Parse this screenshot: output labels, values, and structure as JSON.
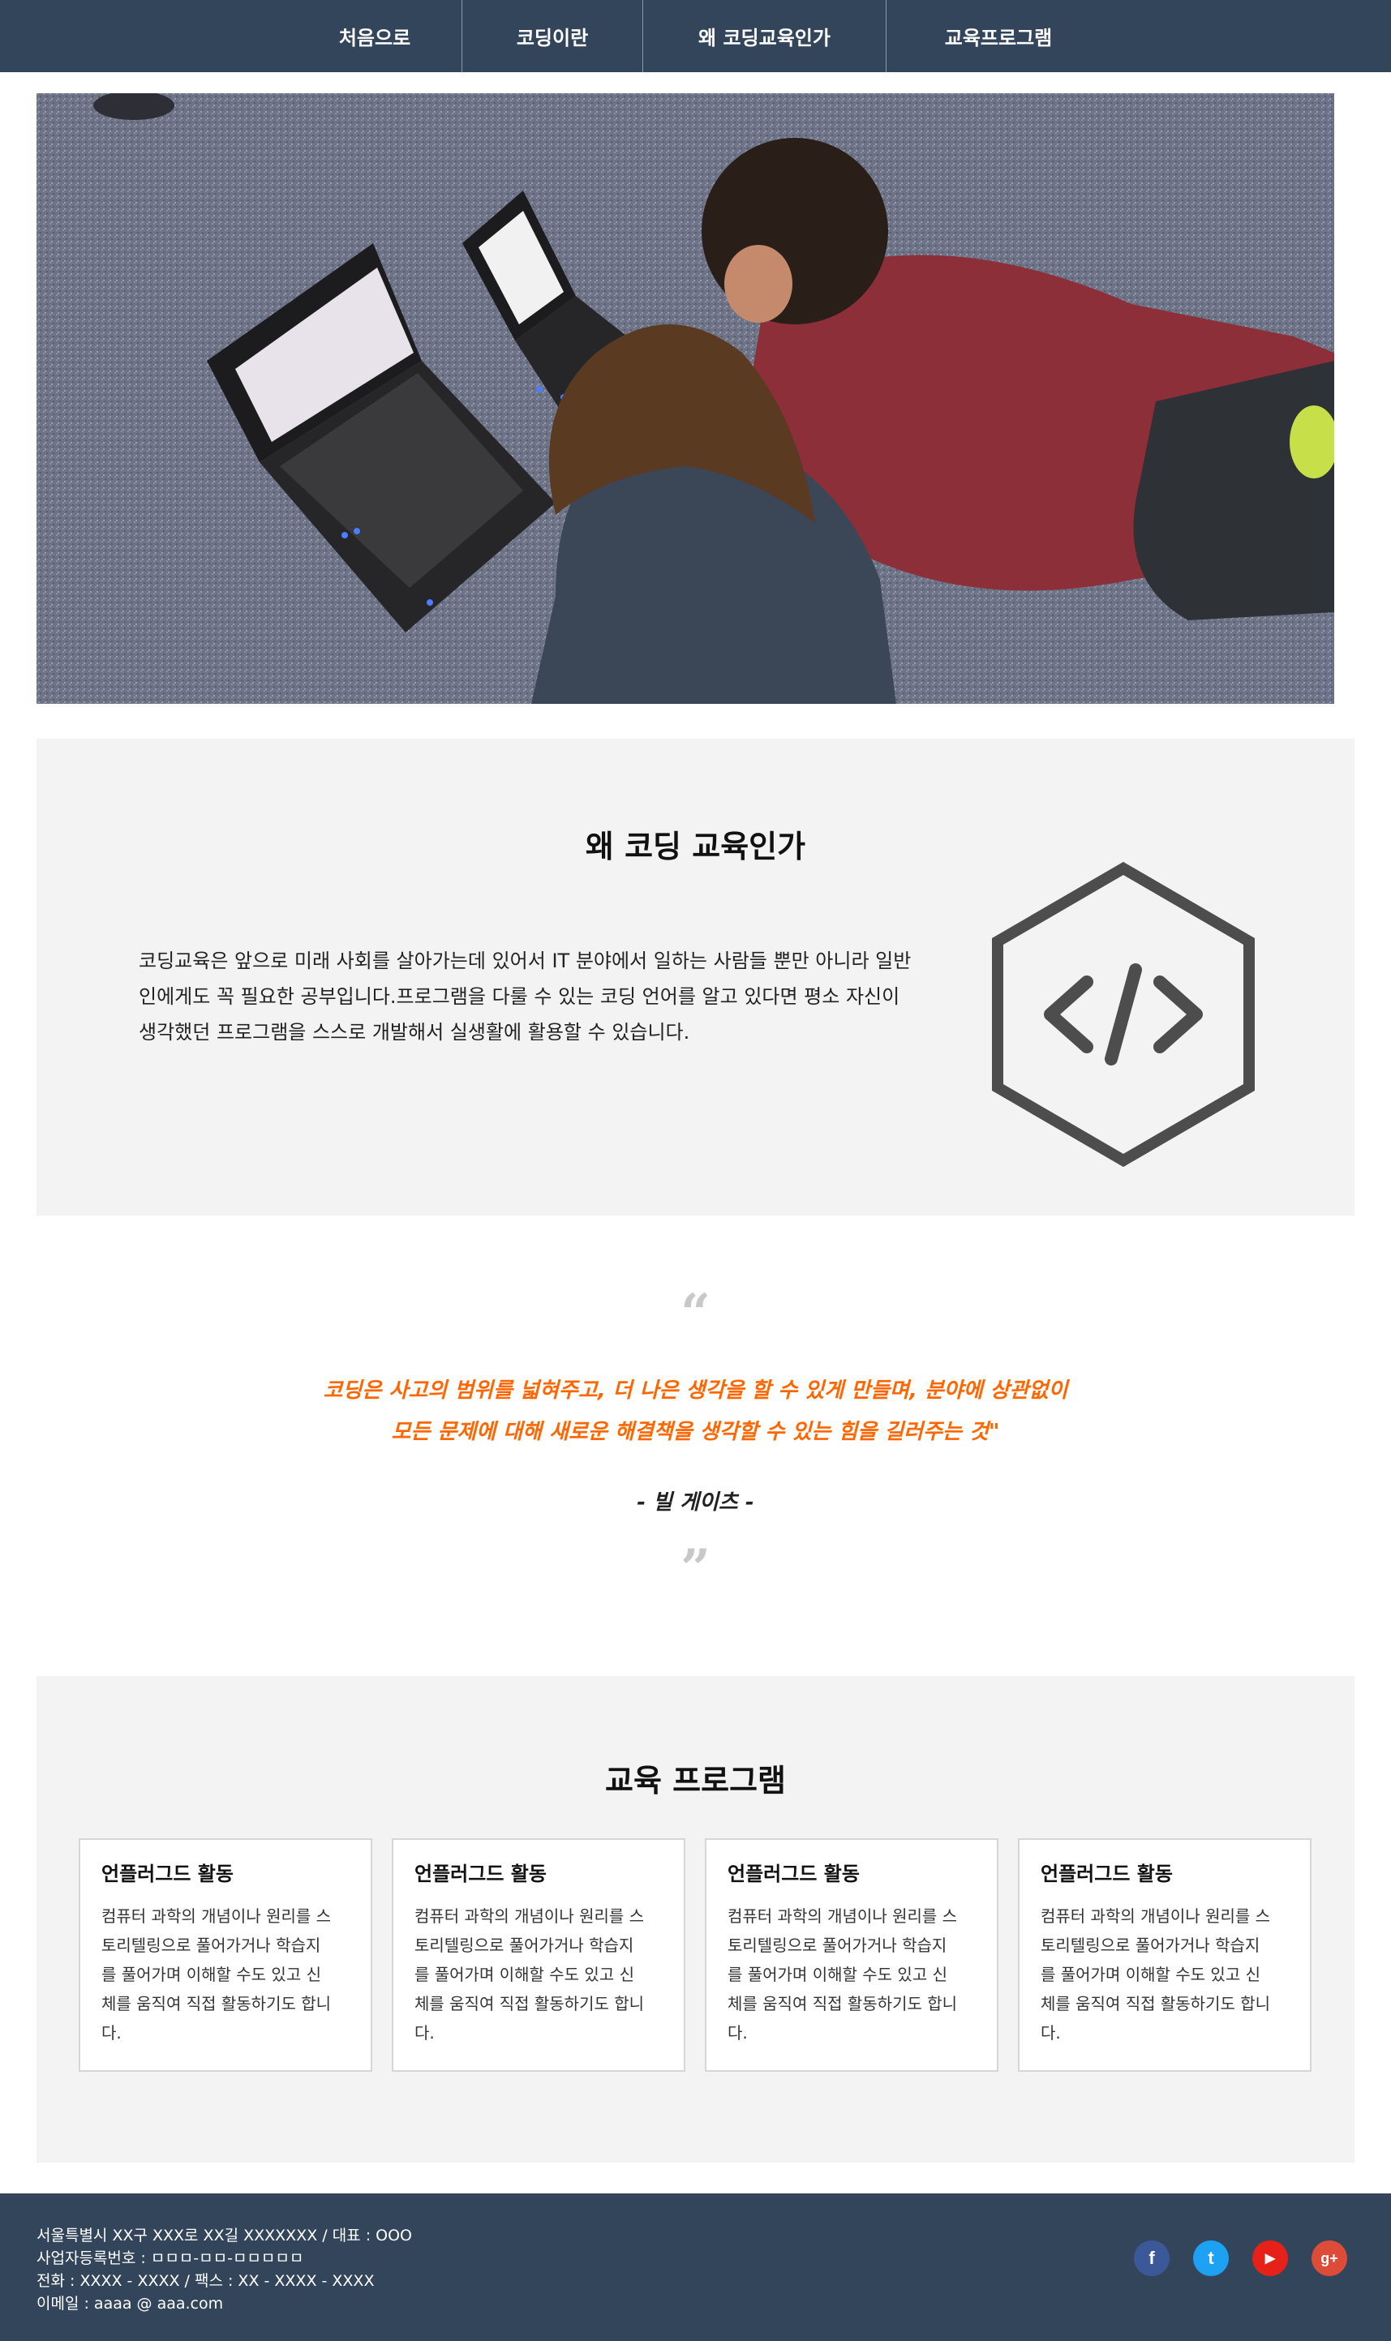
{
  "nav": {
    "items": [
      {
        "label": "처음으로"
      },
      {
        "label": "코딩이란"
      },
      {
        "label": "왜 코딩교육인가"
      },
      {
        "label": "교육프로그램"
      }
    ]
  },
  "why": {
    "title": "왜 코딩 교육인가",
    "text_lines": [
      "코딩교육은 앞으로 미래 사회를 살아가는데 있어서 IT 분야에서 일하는 사람들 뿐만 아니라 일반",
      "인에게도 꼭 필요한 공부입니다.프로그램을 다룰 수 있는 코딩 언어를 알고 있다면 평소 자신이",
      "생각했던 프로그램을 스스로 개발해서 실생활에 활용할 수 있습니다."
    ],
    "icon": "code-hexagon-icon"
  },
  "quote": {
    "open_mark": "“",
    "line1": "코딩은 사고의 범위를 넓혀주고, 더 나은 생각을 할 수 있게 만들며, 분야에 상관없이",
    "line2": "모든 문제에 대해 새로운 해결책을 생각할 수 있는 힘을 길러주는 것\"",
    "author": "- 빌 게이츠 -",
    "close_mark": "”",
    "color": "#ff6600"
  },
  "programs": {
    "title": "교육 프로그램",
    "cards": [
      {
        "title": "언플러그드 활동",
        "text_lines": [
          "컴퓨터 과학의 개념이나 원리를 스",
          "토리텔링으로 풀어가거나 학습지",
          "를 풀어가며 이해할 수도 있고 신",
          "체를 움직여 직접 활동하기도 합니",
          "다."
        ]
      },
      {
        "title": "언플러그드 활동",
        "text_lines": [
          "컴퓨터 과학의 개념이나 원리를 스",
          "토리텔링으로 풀어가거나 학습지",
          "를 풀어가며 이해할 수도 있고 신",
          "체를 움직여 직접 활동하기도 합니",
          "다."
        ]
      },
      {
        "title": "언플러그드 활동",
        "text_lines": [
          "컴퓨터 과학의 개념이나 원리를 스",
          "토리텔링으로 풀어가거나 학습지",
          "를 풀어가며 이해할 수도 있고 신",
          "체를 움직여 직접 활동하기도 합니",
          "다."
        ]
      },
      {
        "title": "언플러그드 활동",
        "text_lines": [
          "컴퓨터 과학의 개념이나 원리를 스",
          "토리텔링으로 풀어가거나 학습지",
          "를 풀어가며 이해할 수도 있고 신",
          "체를 움직여 직접 활동하기도 합니",
          "다."
        ]
      }
    ]
  },
  "footer": {
    "address": "서울특별시 XX구 XXX로 XX길 XXXXXXX / 대표 : OOO",
    "business_no": "사업자등록번호 : ㅁㅁㅁ-ㅁㅁ-ㅁㅁㅁㅁㅁ",
    "phone": "전화 : XXXX - XXXX / 팩스 : XX - XXXX - XXXX",
    "email": "이메일 : aaaa @ aaa.com",
    "social": [
      {
        "icon": "facebook-icon",
        "glyph": "f",
        "color": "#3b5998"
      },
      {
        "icon": "twitter-icon",
        "glyph": "t",
        "color": "#1da1f2"
      },
      {
        "icon": "youtube-icon",
        "glyph": "▶",
        "color": "#e62117"
      },
      {
        "icon": "google-plus-icon",
        "glyph": "g+",
        "color": "#dd4b39"
      }
    ]
  }
}
